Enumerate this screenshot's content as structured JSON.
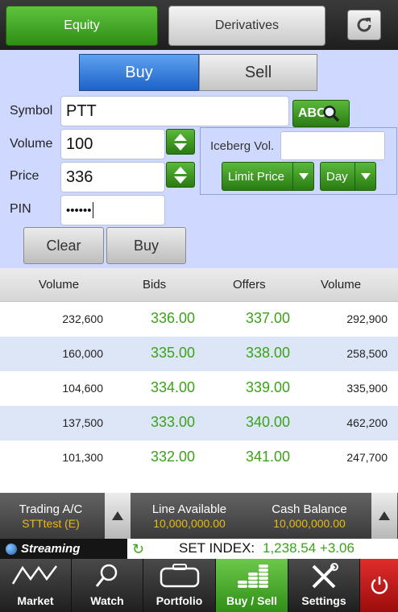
{
  "header": {
    "equity_label": "Equity",
    "derivatives_label": "Derivatives"
  },
  "form": {
    "buy_tab": "Buy",
    "sell_tab": "Sell",
    "symbol_label": "Symbol",
    "symbol_value": "PTT",
    "lookup_label": "ABC",
    "volume_label": "Volume",
    "volume_value": "100",
    "price_label": "Price",
    "price_value": "336",
    "pin_label": "PIN",
    "pin_value": "••••••",
    "iceberg_label": "Iceberg Vol.",
    "price_type": "Limit Price",
    "validity": "Day",
    "clear_label": "Clear",
    "submit_label": "Buy"
  },
  "depth": {
    "headers": [
      "Volume",
      "Bids",
      "Offers",
      "Volume"
    ],
    "rows": [
      {
        "bid_vol": "232,600",
        "bid": "336.00",
        "offer": "337.00",
        "offer_vol": "292,900"
      },
      {
        "bid_vol": "160,000",
        "bid": "335.00",
        "offer": "338.00",
        "offer_vol": "258,500"
      },
      {
        "bid_vol": "104,600",
        "bid": "334.00",
        "offer": "339.00",
        "offer_vol": "335,900"
      },
      {
        "bid_vol": "137,500",
        "bid": "333.00",
        "offer": "340.00",
        "offer_vol": "462,200"
      },
      {
        "bid_vol": "101,300",
        "bid": "332.00",
        "offer": "341.00",
        "offer_vol": "247,700"
      }
    ]
  },
  "account": {
    "trading_label": "Trading A/C",
    "trading_value": "STTtest (E)",
    "line_label": "Line Available",
    "line_value": "10,000,000.00",
    "cash_label": "Cash Balance",
    "cash_value": "10,000,000.00"
  },
  "ticker": {
    "brand": "Streaming",
    "index_label": "SET INDEX:",
    "index_value": "1,238.54  +3.06"
  },
  "nav": {
    "items": [
      "Market",
      "Watch",
      "Portfolio",
      "Buy / Sell",
      "Settings"
    ]
  },
  "colors": {
    "accent_green": "#3aa317",
    "buy_blue": "#1d62c8",
    "form_bg": "#cfd9ff",
    "account_value": "#e8b917",
    "power_red": "#c91818"
  }
}
